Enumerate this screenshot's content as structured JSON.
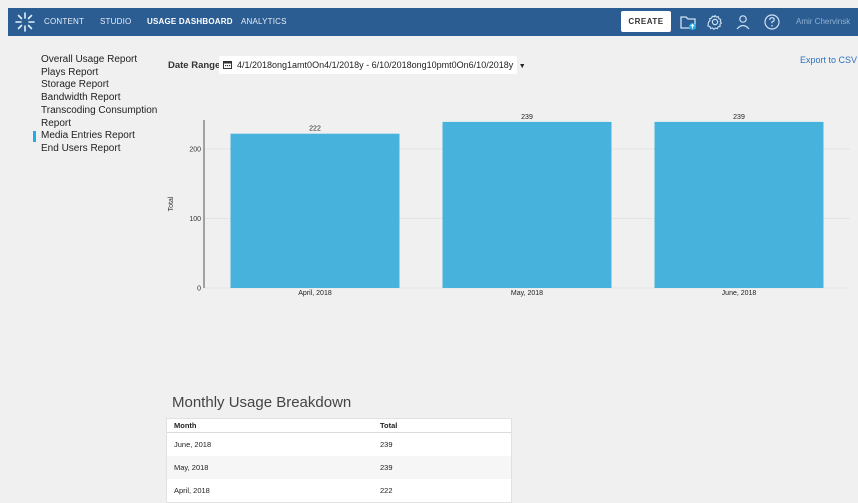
{
  "nav": {
    "items": [
      "CONTENT",
      "STUDIO",
      "USAGE DASHBOARD",
      "ANALYTICS"
    ],
    "active_index": 2,
    "create_label": "CREATE",
    "user_name": "Amir Chervinsk"
  },
  "sidebar": {
    "items": [
      {
        "label": "Overall Usage Report"
      },
      {
        "label": "Plays Report"
      },
      {
        "label": "Storage Report"
      },
      {
        "label": "Bandwidth Report"
      },
      {
        "label": "Transcoding Consumption Report"
      },
      {
        "label": "Media Entries Report"
      },
      {
        "label": "End Users Report"
      }
    ],
    "active_index": 5
  },
  "filters": {
    "date_range_label": "Date Range",
    "date_range_value": "4/1/2018ong1amt0On4/1/2018y - 6/10/2018ong10pmt0On6/10/2018y",
    "export_label": "Export to CSV"
  },
  "chart_data": {
    "type": "bar",
    "categories": [
      "April, 2018",
      "May, 2018",
      "June, 2018"
    ],
    "values": [
      222,
      239,
      239
    ],
    "data_labels": [
      "222",
      "239",
      "239"
    ],
    "ylabel": "Total",
    "yticks": [
      0,
      100,
      200
    ],
    "ylim": [
      0,
      240
    ],
    "bar_color": "#47b3dd",
    "grid": true
  },
  "table": {
    "title": "Monthly Usage Breakdown",
    "columns": [
      "Month",
      "Total"
    ],
    "rows": [
      [
        "June, 2018",
        "239"
      ],
      [
        "May, 2018",
        "239"
      ],
      [
        "April, 2018",
        "222"
      ]
    ]
  },
  "colors": {
    "nav_bg": "#2b5d92",
    "accent": "#1eb0e4",
    "link": "#2d72c4",
    "page_bg": "#f1f0f0"
  }
}
